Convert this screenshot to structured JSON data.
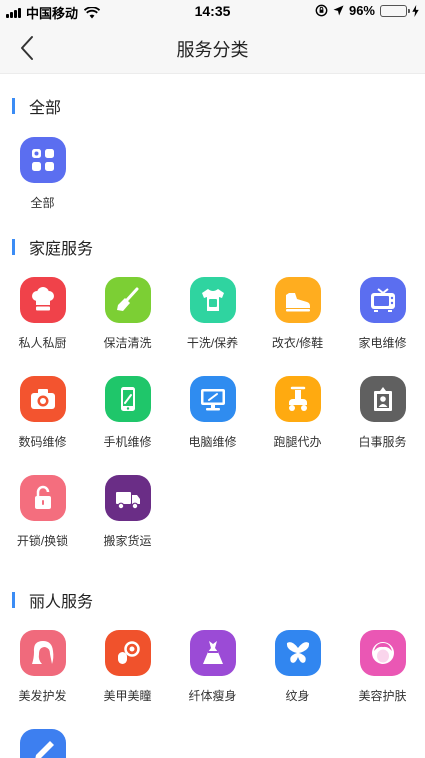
{
  "status": {
    "carrier": "中国移动",
    "time": "14:35",
    "battery": "96%",
    "battery_level": 0.96
  },
  "nav": {
    "title": "服务分类"
  },
  "sections": [
    {
      "title": "全部",
      "items": [
        {
          "label": "全部",
          "icon": "grid-apps-icon",
          "color": "#5b6ef0"
        }
      ]
    },
    {
      "title": "家庭服务",
      "items": [
        {
          "label": "私人私厨",
          "icon": "chef-hat-icon",
          "color": "#f0424a"
        },
        {
          "label": "保洁清洗",
          "icon": "broom-icon",
          "color": "#7ccf34"
        },
        {
          "label": "干洗/保养",
          "icon": "shirt-icon",
          "color": "#2fd4a0"
        },
        {
          "label": "改衣/修鞋",
          "icon": "shoe-icon",
          "color": "#ffad1f"
        },
        {
          "label": "家电维修",
          "icon": "tv-repair-icon",
          "color": "#5b6ef0"
        },
        {
          "label": "数码维修",
          "icon": "camera-icon",
          "color": "#f3542f"
        },
        {
          "label": "手机维修",
          "icon": "phone-repair-icon",
          "color": "#1fc66a"
        },
        {
          "label": "电脑维修",
          "icon": "monitor-repair-icon",
          "color": "#2f8cf0"
        },
        {
          "label": "跑腿代办",
          "icon": "scooter-icon",
          "color": "#ffaa10"
        },
        {
          "label": "白事服务",
          "icon": "memorial-frame-icon",
          "color": "#606060"
        },
        {
          "label": "开锁/换锁",
          "icon": "unlock-icon",
          "color": "#f46e7e"
        },
        {
          "label": "搬家货运",
          "icon": "truck-icon",
          "color": "#6a2d86"
        }
      ]
    },
    {
      "title": "丽人服务",
      "items": [
        {
          "label": "美发护发",
          "icon": "hair-icon",
          "color": "#f06a7c"
        },
        {
          "label": "美甲美瞳",
          "icon": "nail-eye-icon",
          "color": "#f0522c"
        },
        {
          "label": "纤体瘦身",
          "icon": "slim-dress-icon",
          "color": "#9b4bd6"
        },
        {
          "label": "纹身",
          "icon": "butterfly-icon",
          "color": "#3186f0"
        },
        {
          "label": "美容护肤",
          "icon": "face-care-icon",
          "color": "#ea57b4"
        },
        {
          "label": "",
          "icon": "pen-icon",
          "color": "#3d7ff0"
        }
      ]
    }
  ]
}
